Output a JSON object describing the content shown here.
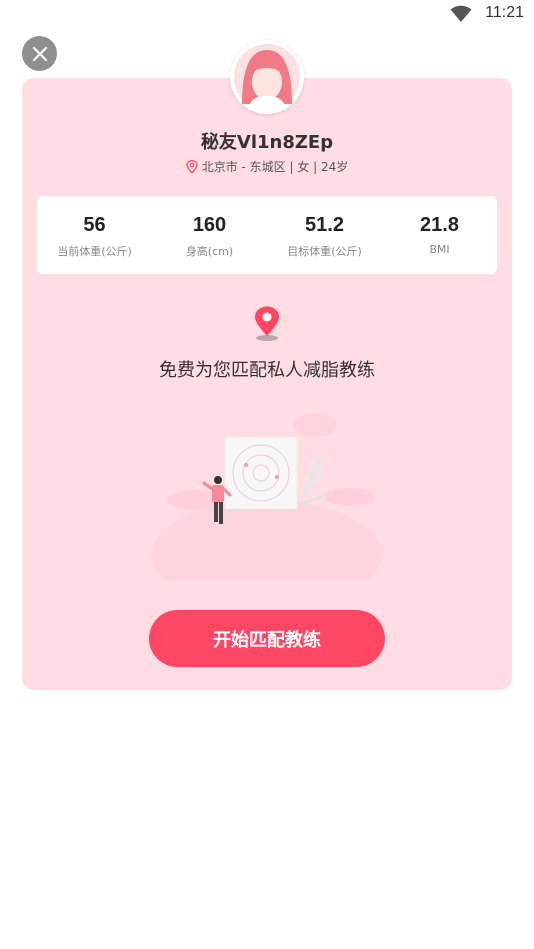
{
  "status_bar": {
    "time": "11:21"
  },
  "profile": {
    "name": "秘友Vl1n8ZEp",
    "meta": "北京市 - 东城区 | 女 | 24岁"
  },
  "stats": [
    {
      "value": "56",
      "label": "当前体重(公斤)"
    },
    {
      "value": "160",
      "label": "身高(cm)"
    },
    {
      "value": "51.2",
      "label": "目标体重(公斤)"
    },
    {
      "value": "21.8",
      "label": "BMI"
    }
  ],
  "tagline": "免费为您匹配私人减脂教练",
  "cta": {
    "label": "开始匹配教练"
  },
  "colors": {
    "card_bg": "#ffdde3",
    "accent": "#ff4765",
    "close_bg": "#8f8f8f"
  },
  "icons": [
    "wifi-icon",
    "close-icon",
    "location-icon",
    "map-pin-icon"
  ]
}
